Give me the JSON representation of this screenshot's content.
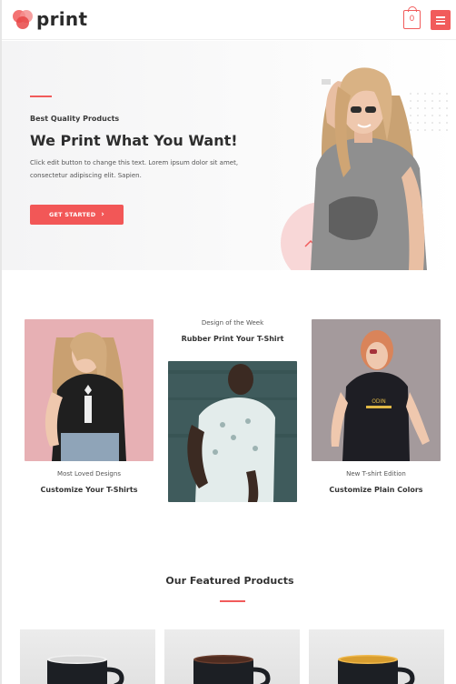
{
  "brand": {
    "name": "print"
  },
  "header": {
    "cart_count": "0",
    "menu_icon": "hamburger-icon",
    "cart_icon": "shopping-bag-icon"
  },
  "hero": {
    "eyebrow": "Best Quality Products",
    "title": "We Print What You Want!",
    "body": "Click edit button to change this text. Lorem ipsum dolor sit amet, consectetur adipiscing elit. Sapien.",
    "cta_label": "GET STARTED",
    "cta_icon": "chevron-right-icon"
  },
  "collections": [
    {
      "eyebrow": "Most Loved Designs",
      "title": "Customize Your T-Shirts"
    },
    {
      "eyebrow": "Design of the Week",
      "title": "Rubber Print Your T-Shirt"
    },
    {
      "eyebrow": "New T-shirt Edition",
      "title": "Customize Plain Colors"
    }
  ],
  "featured": {
    "title": "Our Featured Products"
  },
  "colors": {
    "accent": "#f15b5b",
    "text": "#333333",
    "hero_bg": "#f4f4f5"
  }
}
